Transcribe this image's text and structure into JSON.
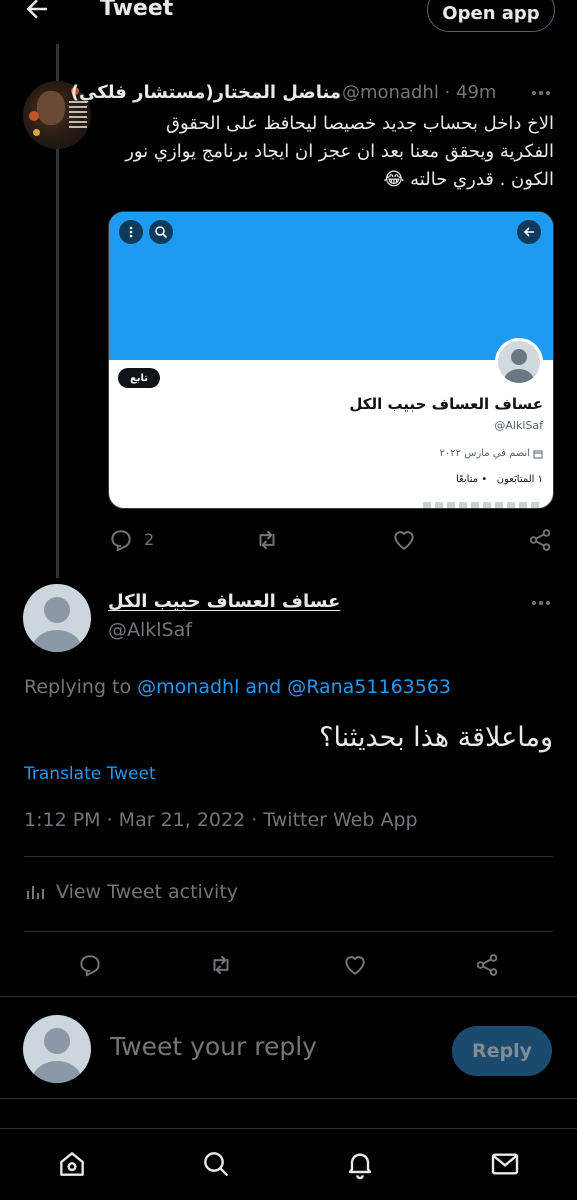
{
  "header": {
    "title": "Tweet",
    "open_app_label": "Open app",
    "back_icon": "arrow-left-icon"
  },
  "parent_tweet": {
    "author_name": "مناضل المختار(مستشار فلكي)",
    "author_handle": "@monadhl",
    "time_ago": " · 49m",
    "text": "الاخ داخل بحساب جديد خصيصا ليحافظ على الحقوق الفكرية ويحقق معنا بعد ان عجز ان ايجاد برنامج يوازي نور الكون . قدري حالته 😂",
    "reply_count": "2",
    "embedded_profile": {
      "name": "عساف العساف حبيب الكل",
      "handle": "@AlklSaf",
      "follow_label": "تابع",
      "joined": "انضم في مارس ٢٠٢٢",
      "following": "١ المتابَعون",
      "followers": "• متابعًا",
      "banner_color": "#1d9bf0"
    }
  },
  "main_tweet": {
    "author_name": "عساف العساف حبيب الكل",
    "author_handle": "@AlklSaf",
    "replying_to_prefix": "Replying to ",
    "replying_to_user1": "@monadhl",
    "replying_to_and": " and ",
    "replying_to_user2": "@Rana51163563",
    "text": "وماعلاقة هذا بحديثنا؟",
    "translate_label": "Translate Tweet",
    "timestamp": "1:12 PM · Mar 21, 2022 · Twitter Web App",
    "activity_label": "View Tweet activity"
  },
  "composer": {
    "placeholder": "Tweet your reply",
    "reply_label": "Reply"
  },
  "bottom_nav": {
    "items": [
      "home-icon",
      "search-icon",
      "notifications-icon",
      "messages-icon"
    ]
  },
  "colors": {
    "background": "#000000",
    "accent": "#1d9bf0",
    "text_primary": "#e7e9ea",
    "text_secondary": "#71767b",
    "divider": "#2f3336"
  }
}
